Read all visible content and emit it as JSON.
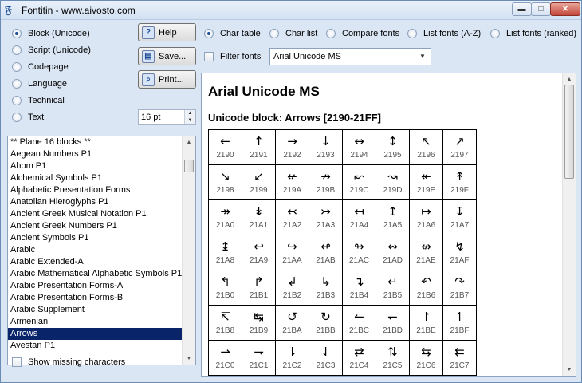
{
  "window": {
    "title": "Fontitin - www.aivosto.com",
    "min_glyph": "▬",
    "max_glyph": "□",
    "close_glyph": "✕"
  },
  "left": {
    "modes": [
      {
        "label": "Block (Unicode)",
        "selected": true
      },
      {
        "label": "Script (Unicode)",
        "selected": false
      },
      {
        "label": "Codepage",
        "selected": false
      },
      {
        "label": "Language",
        "selected": false
      },
      {
        "label": "Technical",
        "selected": false
      },
      {
        "label": "Text",
        "selected": false
      }
    ],
    "buttons": {
      "help": "Help",
      "save": "Save...",
      "print": "Print..."
    },
    "size_value": "16 pt",
    "blocks": [
      "** Plane 16 blocks **",
      "Aegean Numbers P1",
      "Ahom P1",
      "Alchemical Symbols P1",
      "Alphabetic Presentation Forms",
      "Anatolian Hieroglyphs P1",
      "Ancient Greek Musical Notation P1",
      "Ancient Greek Numbers P1",
      "Ancient Symbols P1",
      "Arabic",
      "Arabic Extended-A",
      "Arabic Mathematical Alphabetic Symbols P1",
      "Arabic Presentation Forms-A",
      "Arabic Presentation Forms-B",
      "Arabic Supplement",
      "Armenian",
      "Arrows",
      "Avestan P1"
    ],
    "selected_block": "Arrows",
    "show_missing_label": "Show missing characters"
  },
  "right": {
    "views": [
      {
        "label": "Char table",
        "selected": true
      },
      {
        "label": "Char list",
        "selected": false
      },
      {
        "label": "Compare fonts",
        "selected": false
      },
      {
        "label": "List fonts (A-Z)",
        "selected": false
      },
      {
        "label": "List fonts (ranked)",
        "selected": false
      }
    ],
    "filter_fonts_label": "Filter fonts",
    "font_select": "Arial Unicode MS",
    "content": {
      "font_title": "Arial Unicode MS",
      "block_title": "Unicode block: Arrows [2190-21FF]",
      "rows": [
        [
          {
            "g": "←",
            "c": "2190"
          },
          {
            "g": "↑",
            "c": "2191"
          },
          {
            "g": "→",
            "c": "2192"
          },
          {
            "g": "↓",
            "c": "2193"
          },
          {
            "g": "↔",
            "c": "2194"
          },
          {
            "g": "↕",
            "c": "2195"
          },
          {
            "g": "↖",
            "c": "2196"
          },
          {
            "g": "↗",
            "c": "2197"
          }
        ],
        [
          {
            "g": "↘",
            "c": "2198"
          },
          {
            "g": "↙",
            "c": "2199"
          },
          {
            "g": "↚",
            "c": "219A"
          },
          {
            "g": "↛",
            "c": "219B"
          },
          {
            "g": "↜",
            "c": "219C"
          },
          {
            "g": "↝",
            "c": "219D"
          },
          {
            "g": "↞",
            "c": "219E"
          },
          {
            "g": "↟",
            "c": "219F"
          }
        ],
        [
          {
            "g": "↠",
            "c": "21A0"
          },
          {
            "g": "↡",
            "c": "21A1"
          },
          {
            "g": "↢",
            "c": "21A2"
          },
          {
            "g": "↣",
            "c": "21A3"
          },
          {
            "g": "↤",
            "c": "21A4"
          },
          {
            "g": "↥",
            "c": "21A5"
          },
          {
            "g": "↦",
            "c": "21A6"
          },
          {
            "g": "↧",
            "c": "21A7"
          }
        ],
        [
          {
            "g": "↨",
            "c": "21A8"
          },
          {
            "g": "↩",
            "c": "21A9"
          },
          {
            "g": "↪",
            "c": "21AA"
          },
          {
            "g": "↫",
            "c": "21AB"
          },
          {
            "g": "↬",
            "c": "21AC"
          },
          {
            "g": "↭",
            "c": "21AD"
          },
          {
            "g": "↮",
            "c": "21AE"
          },
          {
            "g": "↯",
            "c": "21AF"
          }
        ],
        [
          {
            "g": "↰",
            "c": "21B0"
          },
          {
            "g": "↱",
            "c": "21B1"
          },
          {
            "g": "↲",
            "c": "21B2"
          },
          {
            "g": "↳",
            "c": "21B3"
          },
          {
            "g": "↴",
            "c": "21B4"
          },
          {
            "g": "↵",
            "c": "21B5"
          },
          {
            "g": "↶",
            "c": "21B6"
          },
          {
            "g": "↷",
            "c": "21B7"
          }
        ],
        [
          {
            "g": "↸",
            "c": "21B8"
          },
          {
            "g": "↹",
            "c": "21B9"
          },
          {
            "g": "↺",
            "c": "21BA"
          },
          {
            "g": "↻",
            "c": "21BB"
          },
          {
            "g": "↼",
            "c": "21BC"
          },
          {
            "g": "↽",
            "c": "21BD"
          },
          {
            "g": "↾",
            "c": "21BE"
          },
          {
            "g": "↿",
            "c": "21BF"
          }
        ],
        [
          {
            "g": "⇀",
            "c": "21C0"
          },
          {
            "g": "⇁",
            "c": "21C1"
          },
          {
            "g": "⇂",
            "c": "21C2"
          },
          {
            "g": "⇃",
            "c": "21C3"
          },
          {
            "g": "⇄",
            "c": "21C4"
          },
          {
            "g": "⇅",
            "c": "21C5"
          },
          {
            "g": "⇆",
            "c": "21C6"
          },
          {
            "g": "⇇",
            "c": "21C7"
          }
        ]
      ]
    }
  },
  "colors": {
    "selection": "#0a246a",
    "window_bg": "#dbe6f4",
    "accent": "#1d4f98"
  }
}
